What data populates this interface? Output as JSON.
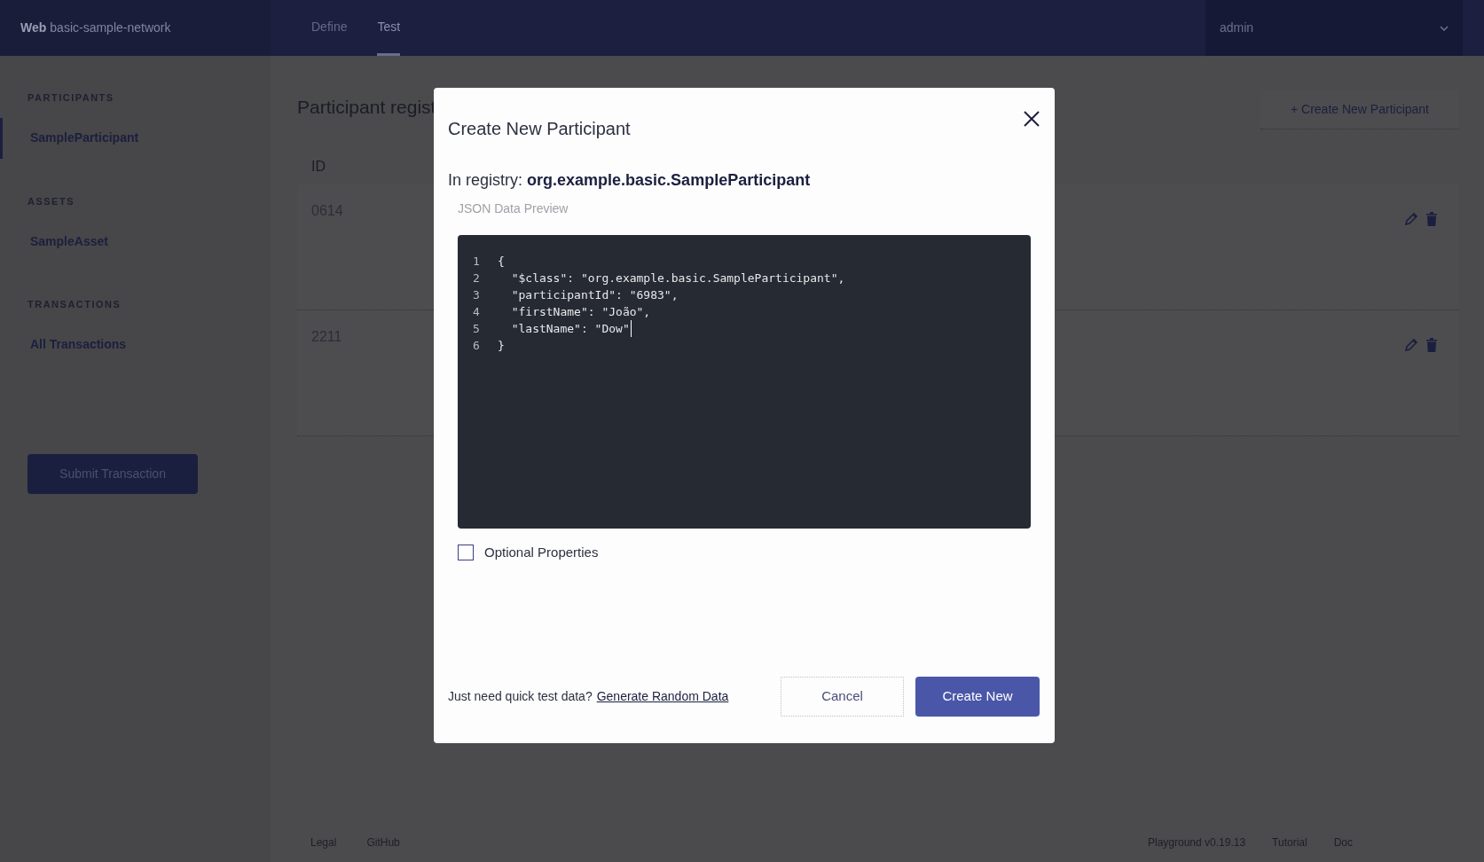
{
  "header": {
    "brand": {
      "name": "Web",
      "network": "basic-sample-network"
    },
    "tabs": [
      {
        "label": "Define",
        "selected": false
      },
      {
        "label": "Test",
        "selected": true
      }
    ],
    "user": "admin"
  },
  "sidebar": {
    "sections": [
      {
        "title": "PARTICIPANTS",
        "items": [
          {
            "label": "SampleParticipant",
            "selected": true
          }
        ]
      },
      {
        "title": "ASSETS",
        "items": [
          {
            "label": "SampleAsset",
            "selected": false
          }
        ]
      },
      {
        "title": "TRANSACTIONS",
        "items": [
          {
            "label": "All Transactions",
            "selected": false
          }
        ]
      }
    ],
    "submit_button": "Submit Transaction"
  },
  "main": {
    "title": "Participant regist",
    "create_button": "+ Create New Participant",
    "table": {
      "columns": [
        "ID"
      ],
      "rows": [
        {
          "id": "0614"
        },
        {
          "id": "2211"
        }
      ]
    }
  },
  "footer": {
    "left": [
      "Legal",
      "GitHub"
    ],
    "right": [
      "Playground v0.19.13",
      "Tutorial",
      "Doc"
    ]
  },
  "dialog": {
    "title": "Create New Participant",
    "registry_label": "In registry:",
    "registry_name": "org.example.basic.SampleParticipant",
    "preview_label": "JSON Data Preview",
    "code_lines": [
      {
        "number": "1",
        "text": "{",
        "cursor": false
      },
      {
        "number": "2",
        "text": "  \"$class\": \"org.example.basic.SampleParticipant\",",
        "cursor": false
      },
      {
        "number": "3",
        "text": "  \"participantId\": \"6983\",",
        "cursor": false
      },
      {
        "number": "4",
        "text": "  \"firstName\": \"João\",",
        "cursor": false
      },
      {
        "number": "5",
        "text": "  \"lastName\": \"Dow\"",
        "cursor": true
      },
      {
        "number": "6",
        "text": "}",
        "cursor": false
      }
    ],
    "optional_properties": {
      "label": "Optional Properties",
      "checked": false
    },
    "prompt": "Just need quick test data?",
    "link": "Generate Random Data",
    "cancel_button": "Cancel",
    "create_button": "Create New"
  }
}
